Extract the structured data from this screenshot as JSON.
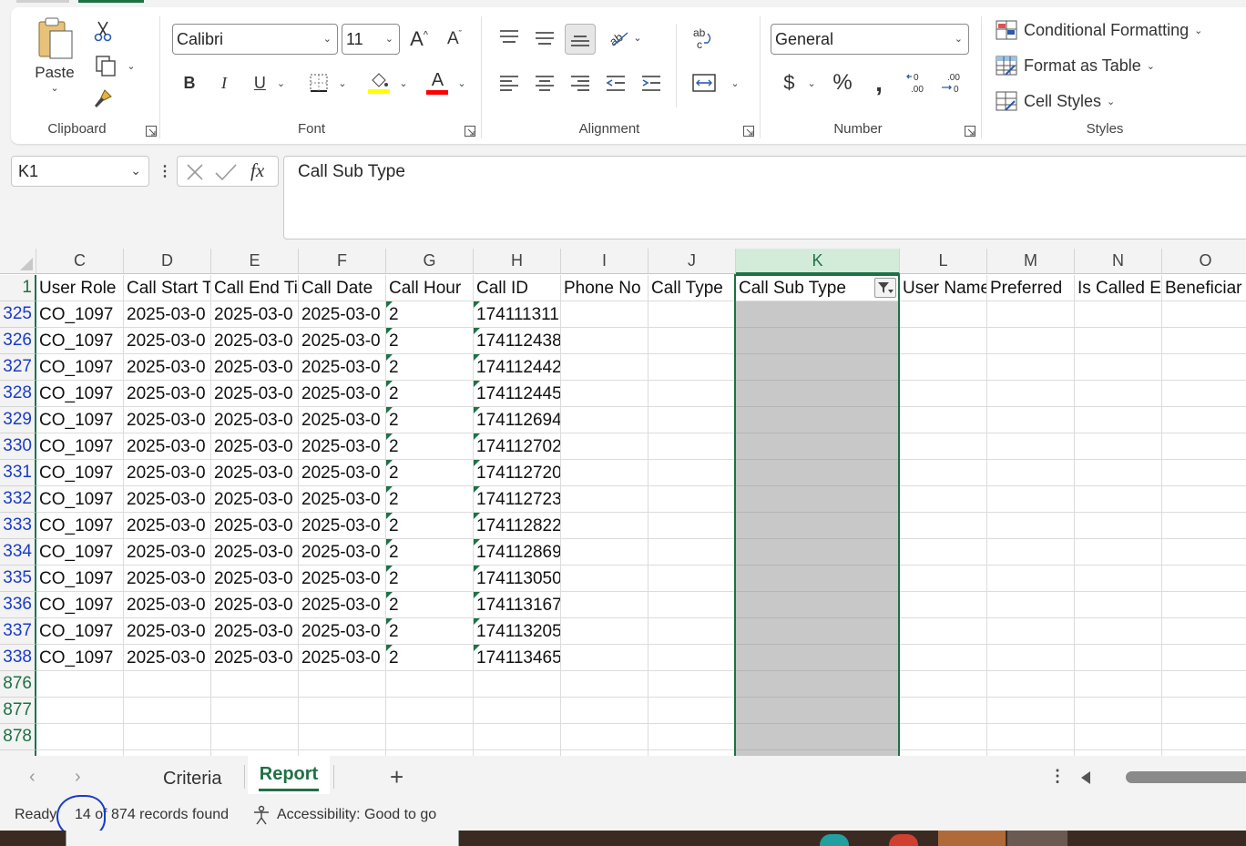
{
  "ribbon": {
    "clipboard": {
      "paste_label": "Paste",
      "group_label": "Clipboard"
    },
    "font": {
      "font_name": "Calibri",
      "font_size": "11",
      "group_label": "Font",
      "fill_color": "#ffff00",
      "font_color": "#ff0000"
    },
    "alignment": {
      "group_label": "Alignment"
    },
    "number": {
      "format": "General",
      "group_label": "Number"
    },
    "styles": {
      "conditional_formatting": "Conditional Formatting",
      "format_as_table": "Format as Table",
      "cell_styles": "Cell Styles",
      "group_label": "Styles"
    }
  },
  "formula_bar": {
    "name_box": "K1",
    "formula": "Call Sub Type"
  },
  "sheet": {
    "columns": [
      {
        "letter": "C",
        "header": "User Role"
      },
      {
        "letter": "D",
        "header": "Call Start T"
      },
      {
        "letter": "E",
        "header": "Call End Ti"
      },
      {
        "letter": "F",
        "header": "Call Date"
      },
      {
        "letter": "G",
        "header": "Call Hour"
      },
      {
        "letter": "H",
        "header": "Call ID"
      },
      {
        "letter": "I",
        "header": "Phone No"
      },
      {
        "letter": "J",
        "header": "Call Type"
      },
      {
        "letter": "K",
        "header": "Call Sub Type"
      },
      {
        "letter": "L",
        "header": "User Name"
      },
      {
        "letter": "M",
        "header": "Preferred"
      },
      {
        "letter": "N",
        "header": "Is Called E"
      },
      {
        "letter": "O",
        "header": "Beneficiar"
      }
    ],
    "header_row_number": "1",
    "rows": [
      {
        "num": "325",
        "role": "CO_1097",
        "start": "2025-03-0",
        "end": "2025-03-0",
        "date": "2025-03-0",
        "hour": "2",
        "id": "174111311"
      },
      {
        "num": "326",
        "role": "CO_1097",
        "start": "2025-03-0",
        "end": "2025-03-0",
        "date": "2025-03-0",
        "hour": "2",
        "id": "174112438"
      },
      {
        "num": "327",
        "role": "CO_1097",
        "start": "2025-03-0",
        "end": "2025-03-0",
        "date": "2025-03-0",
        "hour": "2",
        "id": "174112442"
      },
      {
        "num": "328",
        "role": "CO_1097",
        "start": "2025-03-0",
        "end": "2025-03-0",
        "date": "2025-03-0",
        "hour": "2",
        "id": "174112445"
      },
      {
        "num": "329",
        "role": "CO_1097",
        "start": "2025-03-0",
        "end": "2025-03-0",
        "date": "2025-03-0",
        "hour": "2",
        "id": "174112694"
      },
      {
        "num": "330",
        "role": "CO_1097",
        "start": "2025-03-0",
        "end": "2025-03-0",
        "date": "2025-03-0",
        "hour": "2",
        "id": "174112702"
      },
      {
        "num": "331",
        "role": "CO_1097",
        "start": "2025-03-0",
        "end": "2025-03-0",
        "date": "2025-03-0",
        "hour": "2",
        "id": "174112720"
      },
      {
        "num": "332",
        "role": "CO_1097",
        "start": "2025-03-0",
        "end": "2025-03-0",
        "date": "2025-03-0",
        "hour": "2",
        "id": "174112723"
      },
      {
        "num": "333",
        "role": "CO_1097",
        "start": "2025-03-0",
        "end": "2025-03-0",
        "date": "2025-03-0",
        "hour": "2",
        "id": "174112822"
      },
      {
        "num": "334",
        "role": "CO_1097",
        "start": "2025-03-0",
        "end": "2025-03-0",
        "date": "2025-03-0",
        "hour": "2",
        "id": "174112869"
      },
      {
        "num": "335",
        "role": "CO_1097",
        "start": "2025-03-0",
        "end": "2025-03-0",
        "date": "2025-03-0",
        "hour": "2",
        "id": "174113050"
      },
      {
        "num": "336",
        "role": "CO_1097",
        "start": "2025-03-0",
        "end": "2025-03-0",
        "date": "2025-03-0",
        "hour": "2",
        "id": "174113167"
      },
      {
        "num": "337",
        "role": "CO_1097",
        "start": "2025-03-0",
        "end": "2025-03-0",
        "date": "2025-03-0",
        "hour": "2",
        "id": "174113205"
      },
      {
        "num": "338",
        "role": "CO_1097",
        "start": "2025-03-0",
        "end": "2025-03-0",
        "date": "2025-03-0",
        "hour": "2",
        "id": "174113465"
      }
    ],
    "empty_rows": [
      "876",
      "877",
      "878"
    ]
  },
  "tabs": {
    "items": [
      "Criteria",
      "Report"
    ],
    "active": "Report",
    "add_label": "+"
  },
  "status": {
    "ready": "Ready",
    "records": "14 of 874 records found",
    "accessibility": "Accessibility: Good to go"
  },
  "colors": {
    "excel_green": "#1e7145",
    "filtered_row_number": "#1a3cc8",
    "annotation_circle": "#1a3cc8"
  }
}
